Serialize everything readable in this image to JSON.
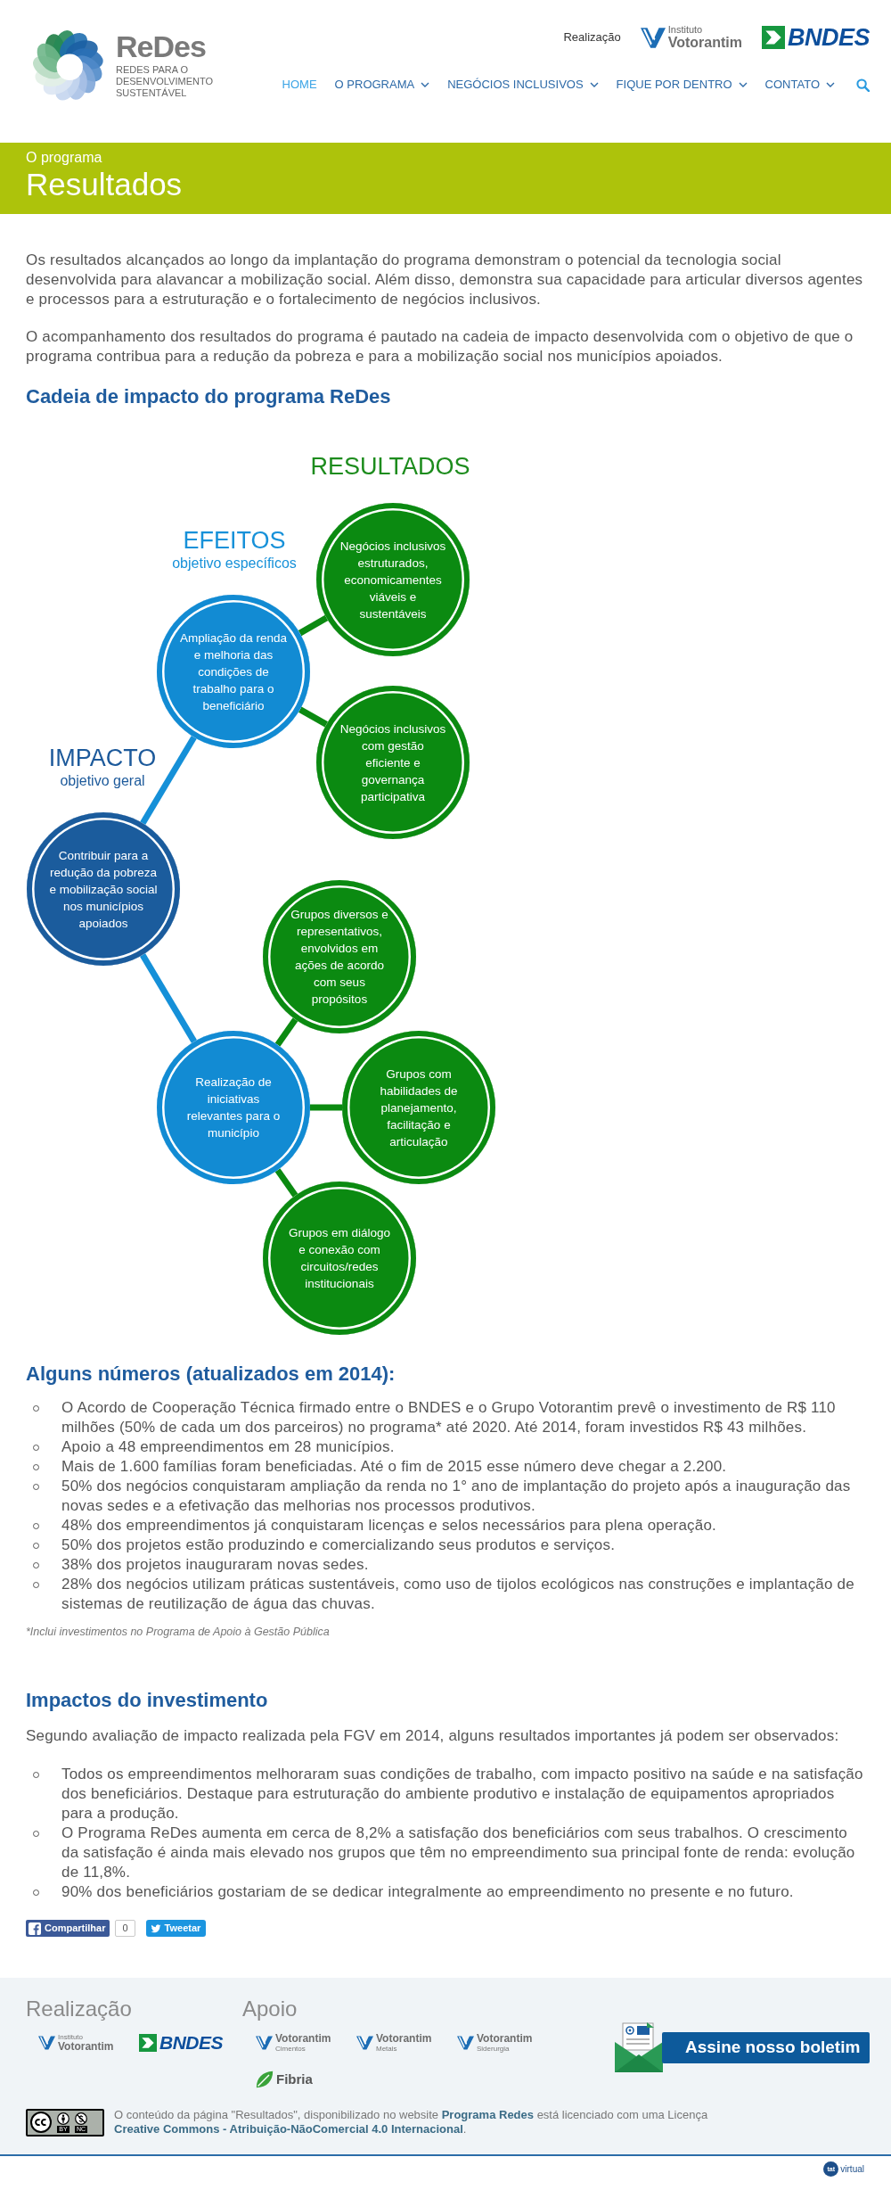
{
  "header": {
    "logo": {
      "name": "ReDes",
      "tagline": "REDES PARA O DESENVOLVIMENTO SUSTENTÁVEL"
    },
    "partners_label": "Realização",
    "partners": [
      {
        "kind": "votorantim",
        "above": "Instituto",
        "name": "Votorantim"
      },
      {
        "kind": "bndes",
        "name": "BNDES"
      }
    ],
    "nav": [
      {
        "label": "HOME",
        "selected": true,
        "has_menu": false
      },
      {
        "label": "O PROGRAMA",
        "selected": false,
        "has_menu": true
      },
      {
        "label": "NEGÓCIOS INCLUSIVOS",
        "selected": false,
        "has_menu": true
      },
      {
        "label": "FIQUE POR DENTRO",
        "selected": false,
        "has_menu": true
      },
      {
        "label": "CONTATO",
        "selected": false,
        "has_menu": true
      }
    ]
  },
  "page_banner": {
    "section": "O programa",
    "title": "Resultados"
  },
  "intro": [
    "Os resultados alcançados ao longo da implantação do programa demonstram o potencial da tecnologia social desenvolvida para alavancar a mobilização social. Além disso, demonstra sua capacidade para articular diversos agentes e processos para a estruturação e o fortalecimento de negócios inclusivos.",
    "O acompanhamento dos resultados do programa é pautado na cadeia de impacto desenvolvida com o objetivo de que o programa contribua para a redução da pobreza e para a mobilização social nos municípios apoiados."
  ],
  "impact_chain": {
    "heading": "Cadeia de impacto do programa ReDes",
    "levels": [
      {
        "kind": "result",
        "title": "RESULTADOS"
      },
      {
        "kind": "effect",
        "title": "EFEITOS",
        "subtitle": "objetivo específicos"
      },
      {
        "kind": "impact",
        "title": "IMPACTO",
        "subtitle": "objetivo geral"
      }
    ],
    "root": {
      "kind": "impact",
      "text": "Contribuir para a redução da pobreza e mobilização social nos municípios apoiados",
      "children": [
        {
          "kind": "effect",
          "text": "Ampliação da renda e melhoria das condições de trabalho para o beneficiário",
          "children": [
            {
              "kind": "result",
              "text": "Negócios inclusivos estruturados, economicamentes viáveis e sustentáveis"
            },
            {
              "kind": "result",
              "text": "Negócios inclusivos com gestão eficiente e governança participativa"
            }
          ]
        },
        {
          "kind": "effect",
          "text": "Realização de iniciativas relevantes para o município",
          "children": [
            {
              "kind": "result",
              "text": "Grupos diversos e representativos, envolvidos em ações de acordo com seus propósitos"
            },
            {
              "kind": "result",
              "text": "Grupos com habilidades de planejamento, facilitação e articulação"
            },
            {
              "kind": "result",
              "text": "Grupos em diálogo e conexão com circuitos/redes institucionais"
            }
          ]
        }
      ]
    }
  },
  "numbers": {
    "heading": "Alguns números (atualizados em 2014):",
    "items": [
      "O Acordo de Cooperação Técnica firmado entre o BNDES e o Grupo Votorantim prevê o investimento de R$ 110 milhões (50% de cada um dos parceiros) no programa* até 2020. Até 2014, foram investidos R$ 43 milhões.",
      "Apoio a 48 empreendimentos em 28 municípios.",
      "Mais de 1.600 famílias foram beneficiadas. Até o fim de 2015 esse número deve chegar a 2.200.",
      "50% dos negócios conquistaram ampliação da renda no 1° ano de implantação do projeto após a inauguração das novas sedes e a efetivação das melhorias nos processos produtivos.",
      "48% dos empreendimentos já conquistaram licenças e selos necessários para plena operação.",
      "50% dos projetos estão produzindo e comercializando seus produtos e serviços.",
      "38% dos projetos inauguraram novas sedes.",
      "28% dos negócios utilizam práticas sustentáveis, como uso de tijolos ecológicos nas construções e implantação de sistemas de reutilização de água das chuvas."
    ],
    "footnote": "*Inclui investimentos no Programa de Apoio à Gestão Pública"
  },
  "investment_impacts": {
    "heading": "Impactos do investimento",
    "lead": "Segundo avaliação de impacto realizada pela FGV em 2014, alguns resultados importantes já podem ser observados:",
    "items": [
      "Todos os empreendimentos melhoraram suas condições de trabalho, com impacto positivo na saúde e na satisfação dos beneficiários. Destaque para estruturação do ambiente produtivo e instalação de equipamentos apropriados para a produção.",
      "O Programa ReDes aumenta em cerca de 8,2% a satisfação dos beneficiários com seus trabalhos. O crescimento da satisfação é ainda mais elevado nos grupos que têm no empreendimento sua principal fonte de renda: evolução de 11,8%.",
      "90% dos beneficiários gostariam de se dedicar integralmente ao empreendimento no presente e no futuro."
    ]
  },
  "share": [
    {
      "kind": "facebook",
      "label": "Compartilhar",
      "count": "0"
    },
    {
      "kind": "twitter",
      "label": "Tweetar"
    }
  ],
  "footer": {
    "columns": [
      {
        "title": "Realização",
        "logos": [
          {
            "kind": "votorantim",
            "above": "Instituto",
            "name": "Votorantim"
          },
          {
            "kind": "bndes",
            "name": "BNDES"
          }
        ]
      },
      {
        "title": "Apoio",
        "logos": [
          {
            "kind": "votorantim",
            "name": "Votorantim",
            "below": "Cimentos"
          },
          {
            "kind": "votorantim",
            "name": "Votorantim",
            "below": "Metais"
          },
          {
            "kind": "votorantim",
            "name": "Votorantim",
            "below": "Siderurgia"
          },
          {
            "kind": "fibria",
            "name": "Fibria"
          }
        ]
      }
    ],
    "newsletter": "Assine nosso boletim",
    "license": {
      "badge": [
        {
          "kind": "by",
          "label": "BY"
        },
        {
          "kind": "nc",
          "label": "NC"
        }
      ],
      "parts": [
        {
          "kind": "text",
          "text": "O conteúdo da página \"Resultados\", disponibilizado no website "
        },
        {
          "kind": "link",
          "text": "Programa Redes"
        },
        {
          "kind": "text",
          "text": " está licenciado com uma Licença "
        },
        {
          "kind": "link",
          "text": "Creative Commons - Atribuição-NãoComercial 4.0 Internacional"
        },
        {
          "kind": "text",
          "text": "."
        }
      ]
    },
    "credit": {
      "mark": "tat",
      "name": "virtual"
    }
  }
}
